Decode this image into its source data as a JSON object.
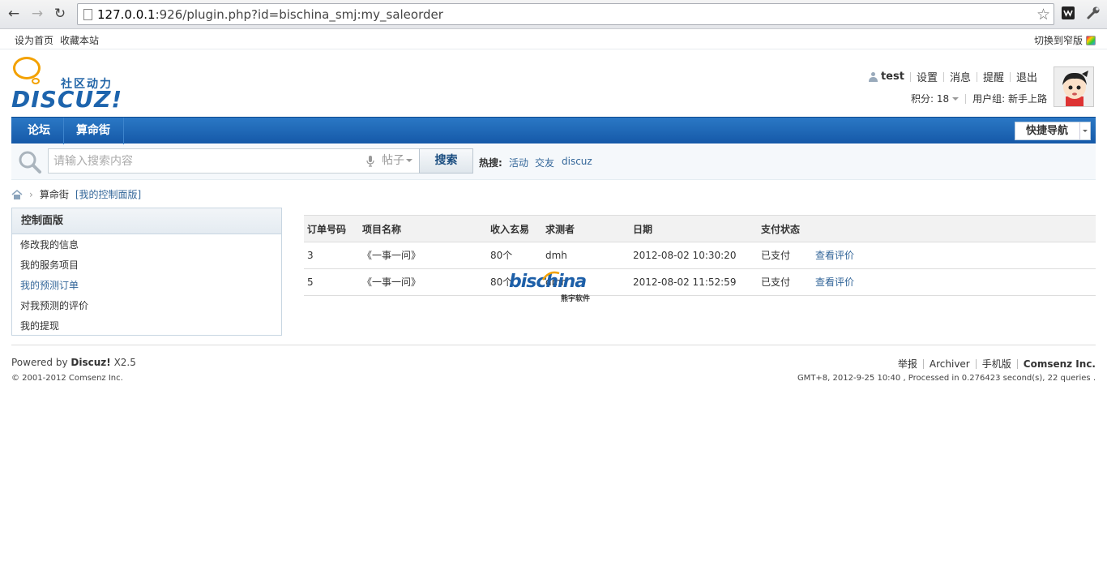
{
  "browser": {
    "url_host": "127.0.0.1",
    "url_rest": ":926/plugin.php?id=bischina_smj:my_saleorder"
  },
  "topbar": {
    "links": [
      "设为首页",
      "收藏本站"
    ],
    "switch_label": "切换到窄版"
  },
  "logo": {
    "slogan": "社区动力",
    "text": "DISCUZ!"
  },
  "user": {
    "name": "test",
    "links": [
      "设置",
      "消息",
      "提醒",
      "退出"
    ],
    "credits_label": "积分: 18",
    "group_label": "用户组: 新手上路"
  },
  "nav": {
    "items": [
      "论坛",
      "算命街"
    ],
    "quick_nav_label": "快捷导航"
  },
  "search": {
    "placeholder": "请输入搜索内容",
    "type_label": "帖子",
    "button_label": "搜索",
    "hot_label": "热搜:",
    "hot_terms": [
      "活动",
      "交友",
      "discuz"
    ]
  },
  "breadcrumb": {
    "section": "算命街",
    "current": "[我的控制面版]"
  },
  "sidebar": {
    "title": "控制面版",
    "items": [
      "修改我的信息",
      "我的服务项目",
      "我的预测订单",
      "对我预测的评价",
      "我的提现"
    ]
  },
  "table": {
    "headers": [
      "订单号码",
      "项目名称",
      "收入玄易",
      "求测者",
      "日期",
      "支付状态"
    ],
    "rows": [
      {
        "id": "3",
        "item": "《一事一问》",
        "income": "80个",
        "user": "dmh",
        "date": "2012-08-02 10:30:20",
        "status": "已支付",
        "action": "查看评价"
      },
      {
        "id": "5",
        "item": "《一事一问》",
        "income": "80个",
        "user": "dmh",
        "date": "2012-08-02 11:52:59",
        "status": "已支付",
        "action": "查看评价"
      }
    ]
  },
  "watermark": {
    "text": "bischina",
    "sub": "熊宇软件"
  },
  "footer": {
    "powered_prefix": "Powered by",
    "powered_brand": "Discuz!",
    "powered_version": "X2.5",
    "copyright": "© 2001-2012 Comsenz Inc.",
    "links": [
      "举报",
      "Archiver",
      "手机版"
    ],
    "brand": "Comsenz Inc.",
    "meta": "GMT+8, 2012-9-25 10:40 , Processed in 0.276423 second(s), 22 queries ."
  },
  "colors": {
    "nav_blue": "#1d64ad",
    "link_blue": "#336699",
    "logo_orange": "#f3a100"
  }
}
